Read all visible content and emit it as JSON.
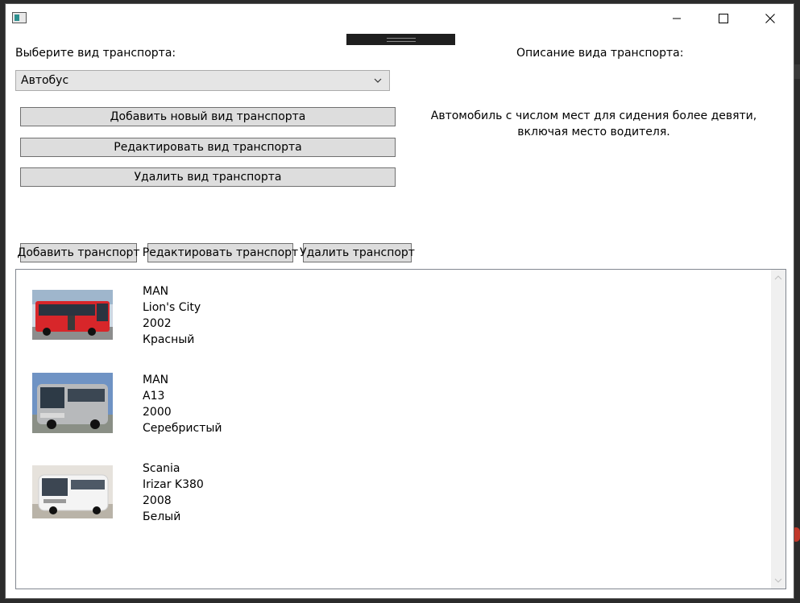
{
  "window": {
    "title": "",
    "icons": {
      "app": "app-icon",
      "minimize": "minimize-icon",
      "maximize": "maximize-icon",
      "close": "close-icon"
    }
  },
  "type_section": {
    "label": "Выберите вид транспорта:",
    "selected": "Автобус",
    "add_type_label": "Добавить новый вид транспорта",
    "edit_type_label": "Редактировать вид транспорта",
    "delete_type_label": "Удалить вид транспорта"
  },
  "description": {
    "label": "Описание вида транспорта:",
    "text": "Автомобиль с числом мест для сидения более девяти, включая место водителя."
  },
  "vehicle_actions": {
    "add_label": "Добавить транспорт",
    "edit_label": "Редактировать транспорт",
    "delete_label": "Удалить транспорт"
  },
  "vehicles": [
    {
      "brand": "MAN",
      "model": "Lion's City",
      "year": "2002",
      "color": "Красный",
      "bus_color": "#d8262a"
    },
    {
      "brand": "MAN",
      "model": "A13",
      "year": "2000",
      "color": "Серебристый",
      "bus_color": "#b7b9bb"
    },
    {
      "brand": "Scania",
      "model": "Irizar K380",
      "year": "2008",
      "color": "Белый",
      "bus_color": "#f2f2f2"
    }
  ]
}
